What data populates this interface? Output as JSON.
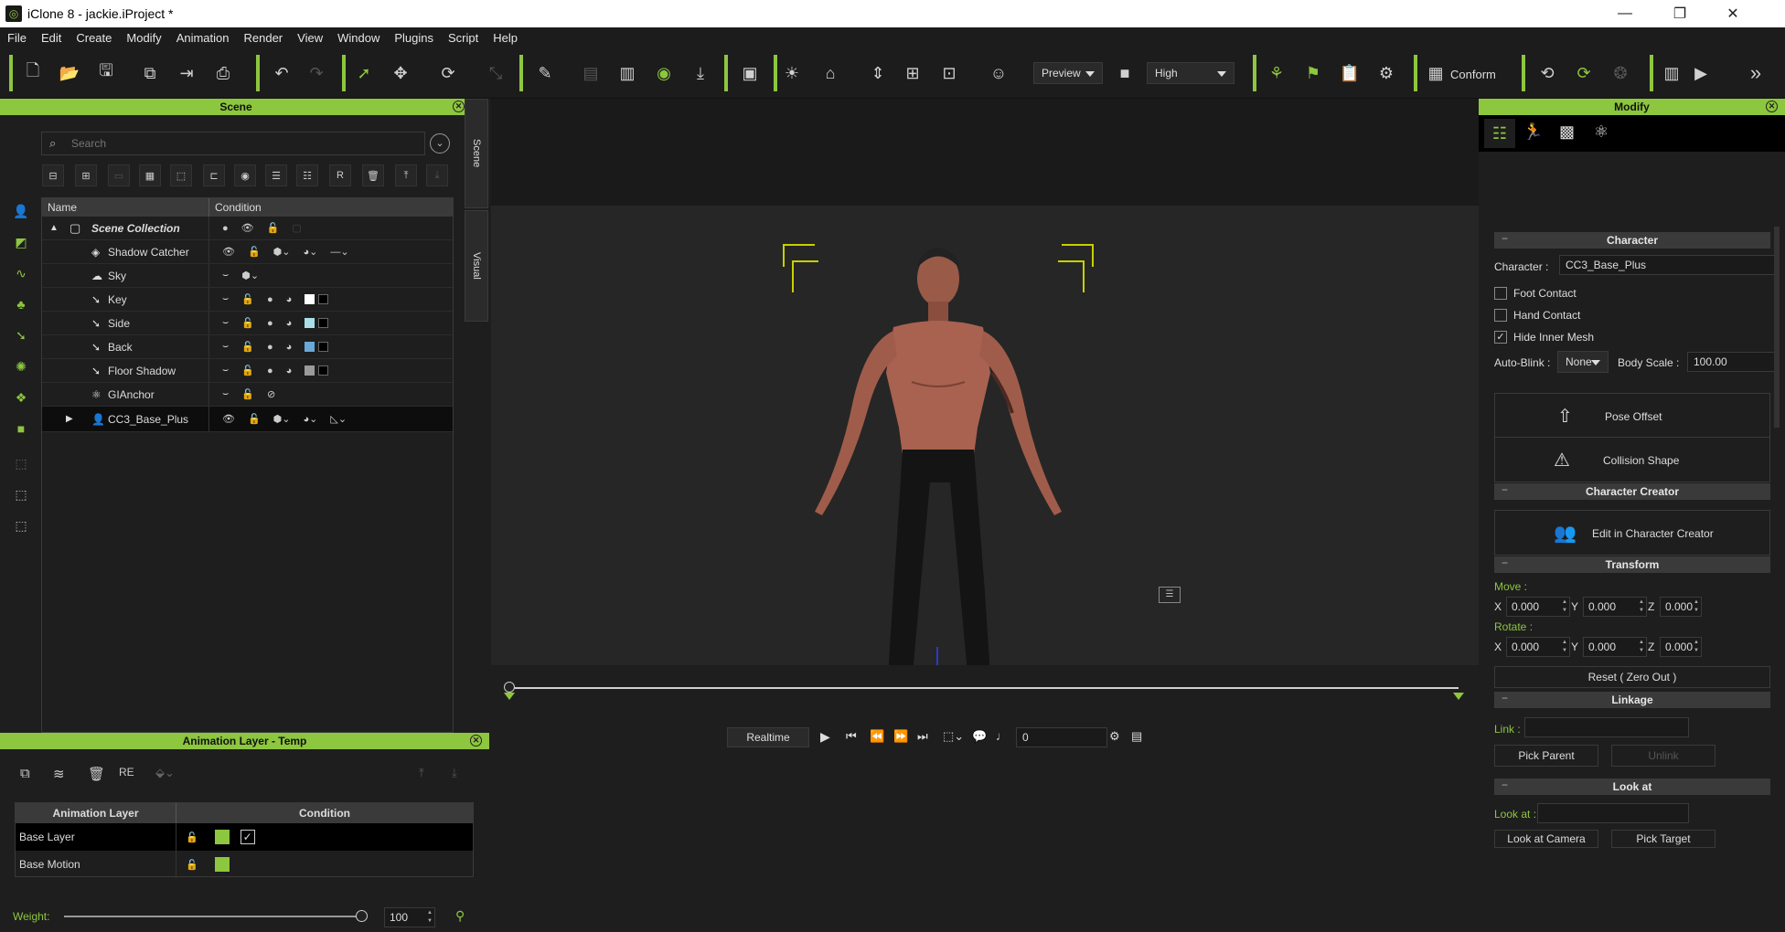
{
  "window": {
    "title": "iClone 8 - jackie.iProject *"
  },
  "menu": [
    "File",
    "Edit",
    "Create",
    "Modify",
    "Animation",
    "Render",
    "View",
    "Window",
    "Plugins",
    "Script",
    "Help"
  ],
  "toolbar": {
    "preview_label": "Preview",
    "quality_label": "High",
    "conform_label": "Conform"
  },
  "scene": {
    "title": "Scene",
    "search_placeholder": "Search",
    "col_name": "Name",
    "col_condition": "Condition",
    "rows": [
      {
        "label": "Scene Collection"
      },
      {
        "label": "Shadow Catcher"
      },
      {
        "label": "Sky"
      },
      {
        "label": "Key",
        "color": "#ffffff"
      },
      {
        "label": "Side",
        "color": "#a8e0e8"
      },
      {
        "label": "Back",
        "color": "#6aa8d8"
      },
      {
        "label": "Floor Shadow",
        "color": "#9a9a9a"
      },
      {
        "label": "GIAnchor"
      },
      {
        "label": "CC3_Base_Plus"
      }
    ],
    "side_tab_scene": "Scene",
    "side_tab_visual": "Visual"
  },
  "anim_layer": {
    "title": "Animation Layer - Temp",
    "col_layer": "Animation Layer",
    "col_condition": "Condition",
    "rows": [
      {
        "label": "Base Layer"
      },
      {
        "label": "Base Motion"
      }
    ],
    "weight_label": "Weight:",
    "weight_value": "100",
    "weight_fraction": 1.0
  },
  "playback": {
    "mode": "Realtime",
    "frame": "0"
  },
  "modify": {
    "title": "Modify",
    "character_section": "Character",
    "character_label": "Character :",
    "character_value": "CC3_Base_Plus",
    "foot_contact": "Foot Contact",
    "hand_contact": "Hand Contact",
    "hide_inner_mesh": "Hide Inner Mesh",
    "auto_blink_label": "Auto-Blink :",
    "auto_blink_value": "None",
    "body_scale_label": "Body Scale :",
    "body_scale_value": "100.00",
    "pose_offset": "Pose Offset",
    "collision_shape": "Collision Shape",
    "cc_section": "Character Creator",
    "edit_in_cc": "Edit in Character Creator",
    "transform_section": "Transform",
    "move_label": "Move :",
    "rotate_label": "Rotate :",
    "x": "X",
    "y": "Y",
    "z": "Z",
    "move": [
      "0.000",
      "0.000",
      "0.000"
    ],
    "rotate": [
      "0.000",
      "0.000",
      "0.000"
    ],
    "reset": "Reset ( Zero Out )",
    "linkage_section": "Linkage",
    "link_label": "Link :",
    "pick_parent": "Pick Parent",
    "unlink": "Unlink",
    "lookat_section": "Look at",
    "lookat_label": "Look at :",
    "lookat_camera": "Look at Camera",
    "pick_target": "Pick Target"
  },
  "colors": {
    "accent": "#8dc63f"
  }
}
